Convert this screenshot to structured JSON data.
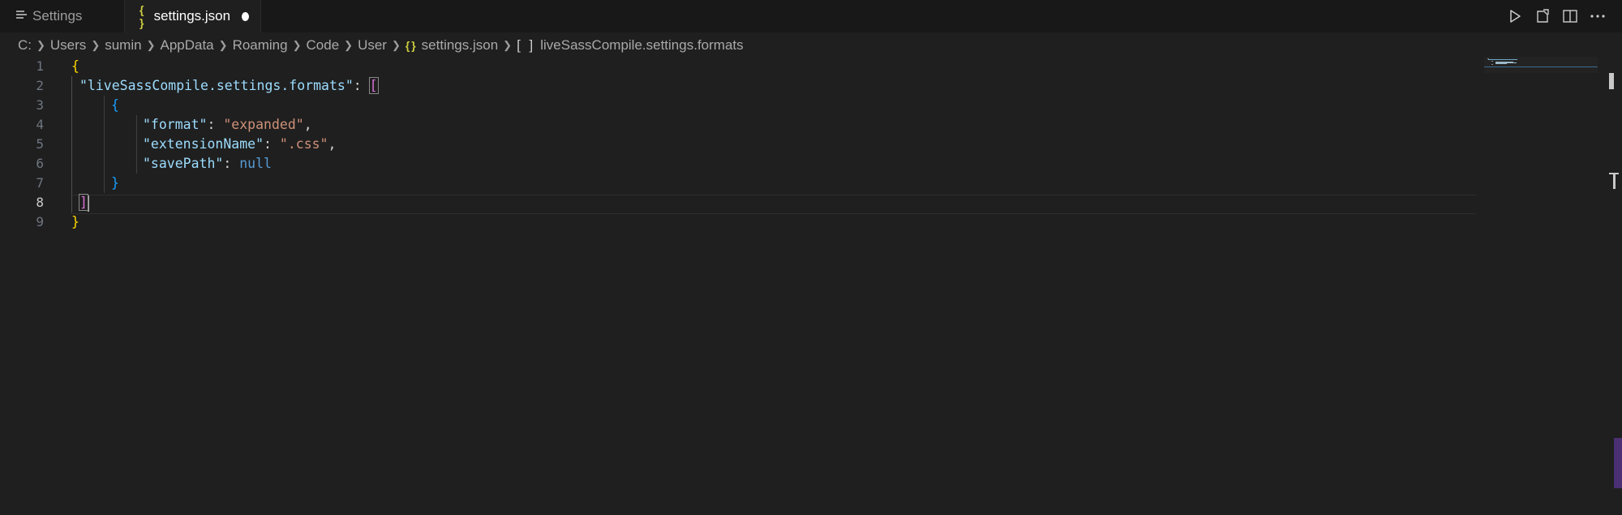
{
  "tabs": [
    {
      "label": "Settings",
      "active": false,
      "icon": "settings-list-icon"
    },
    {
      "label": "settings.json",
      "active": true,
      "icon": "json-braces-icon",
      "dirty": true
    }
  ],
  "tab_actions": [
    "run-icon",
    "open-settings-ui-icon",
    "split-editor-icon",
    "more-actions-icon"
  ],
  "breadcrumb": {
    "drive": "C:",
    "folders": [
      "Users",
      "sumin",
      "AppData",
      "Roaming",
      "Code",
      "User"
    ],
    "json_icon": "{ }",
    "file": "settings.json",
    "array_icon": "[ ]",
    "symbol": "liveSassCompile.settings.formats"
  },
  "editor": {
    "line_numbers": [
      "1",
      "2",
      "3",
      "4",
      "5",
      "6",
      "7",
      "8",
      "9"
    ],
    "current_line": "8",
    "tokens": {
      "l1_brace": "{",
      "l2_key": "\"liveSassCompile.settings.formats\"",
      "l2_colon": ": ",
      "l2_bracket": "[",
      "l3_brace": "{",
      "l4_key": "\"format\"",
      "l4_colon": ": ",
      "l4_value": "\"expanded\"",
      "l4_comma": ",",
      "l5_key": "\"extensionName\"",
      "l5_colon": ": ",
      "l5_value": "\".css\"",
      "l5_comma": ",",
      "l6_key": "\"savePath\"",
      "l6_colon": ": ",
      "l6_value": "null",
      "l7_brace": "}",
      "l8_bracket": "]",
      "l9_brace": "}"
    }
  },
  "colors": {
    "background": "#1f1f1f",
    "tabbar": "#181818",
    "key": "#9cdcfe",
    "string": "#ce9178",
    "null": "#569cd6",
    "bracket_level1": "#ffd700",
    "bracket_level2": "#da70d6",
    "bracket_level3": "#179fff",
    "json_icon": "#cbcb41",
    "scrollbar_accent": "#4a2f73"
  }
}
